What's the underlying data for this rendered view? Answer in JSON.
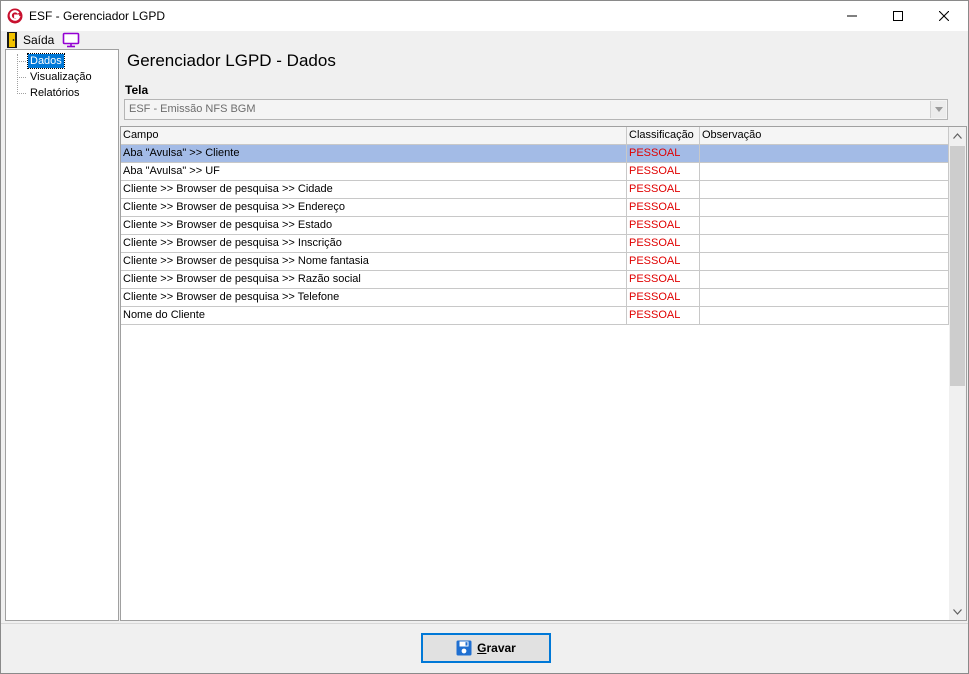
{
  "window": {
    "title": "ESF - Gerenciador LGPD",
    "logo_icon": "app-logo-icon",
    "brand_color": "#c8102e"
  },
  "menu": {
    "exit_label": "Saída",
    "exit_icon": "exit-door-icon",
    "screen_icon": "monitor-icon"
  },
  "tree": {
    "items": [
      {
        "label": "Dados",
        "selected": true
      },
      {
        "label": "Visualização",
        "selected": false
      },
      {
        "label": "Relatórios",
        "selected": false
      }
    ]
  },
  "main": {
    "title": "Gerenciador LGPD - Dados",
    "tela_label": "Tela",
    "tela_value": "ESF - Emissão NFS BGM"
  },
  "grid": {
    "columns": [
      "Campo",
      "Classificação",
      "Observação"
    ],
    "rows": [
      {
        "campo": "Aba \"Avulsa\" >> Cliente",
        "classificacao": "PESSOAL",
        "observacao": ""
      },
      {
        "campo": "Aba \"Avulsa\" >> UF",
        "classificacao": "PESSOAL",
        "observacao": ""
      },
      {
        "campo": "Cliente >> Browser de pesquisa >> Cidade",
        "classificacao": "PESSOAL",
        "observacao": ""
      },
      {
        "campo": "Cliente >> Browser de pesquisa >> Endereço",
        "classificacao": "PESSOAL",
        "observacao": ""
      },
      {
        "campo": "Cliente >> Browser de pesquisa >> Estado",
        "classificacao": "PESSOAL",
        "observacao": ""
      },
      {
        "campo": "Cliente >> Browser de pesquisa >> Inscrição",
        "classificacao": "PESSOAL",
        "observacao": ""
      },
      {
        "campo": "Cliente >> Browser de pesquisa >> Nome fantasia",
        "classificacao": "PESSOAL",
        "observacao": ""
      },
      {
        "campo": "Cliente >> Browser de pesquisa >> Razão social",
        "classificacao": "PESSOAL",
        "observacao": ""
      },
      {
        "campo": "Cliente >> Browser de pesquisa >> Telefone",
        "classificacao": "PESSOAL",
        "observacao": ""
      },
      {
        "campo": "Nome do Cliente",
        "classificacao": "PESSOAL",
        "observacao": ""
      }
    ],
    "selected_row": 0,
    "classification_color": "#e00000",
    "selection_color": "#a3bbe6"
  },
  "footer": {
    "save_mnemonic": "G",
    "save_rest": "ravar",
    "save_icon": "floppy-disk-icon"
  }
}
